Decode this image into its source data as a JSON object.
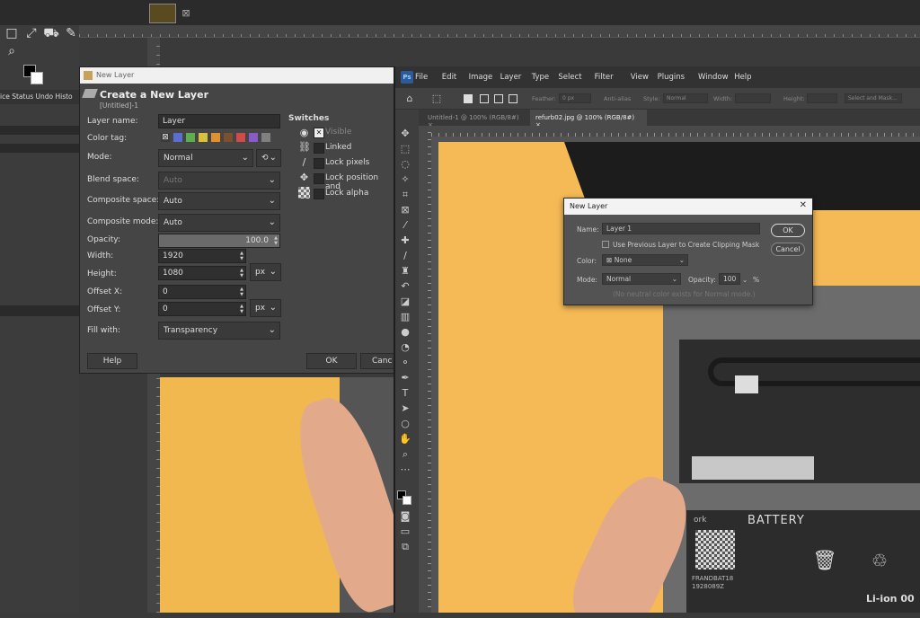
{
  "gimp": {
    "dock_tabs": "ice Status  Undo Histo",
    "dialog": {
      "window_title": "New Layer",
      "header": "Create a New Layer",
      "subtitle": "[Untitled]-1",
      "fields": {
        "layer_name_label": "Layer name:",
        "layer_name_value": "Layer",
        "color_tag_label": "Color tag:",
        "mode_label": "Mode:",
        "mode_value": "Normal",
        "blend_space_label": "Blend space:",
        "blend_space_value": "Auto",
        "composite_space_label": "Composite space:",
        "composite_space_value": "Auto",
        "composite_mode_label": "Composite mode:",
        "composite_mode_value": "Auto",
        "opacity_label": "Opacity:",
        "opacity_value": "100.0",
        "width_label": "Width:",
        "width_value": "1920",
        "height_label": "Height:",
        "height_value": "1080",
        "unit_value": "px",
        "offset_x_label": "Offset X:",
        "offset_x_value": "0",
        "offset_y_label": "Offset Y:",
        "offset_y_value": "0",
        "fill_label": "Fill with:",
        "fill_value": "Transparency"
      },
      "color_tags": [
        "#5a6fd0",
        "#5fae4e",
        "#d9c23a",
        "#e0902e",
        "#7a5030",
        "#d04a4a",
        "#8a5ac8",
        "#808080"
      ],
      "switches": {
        "title": "Switches",
        "visible": "Visible",
        "linked": "Linked",
        "lock_pixels": "Lock pixels",
        "lock_position": "Lock position and",
        "lock_alpha": "Lock alpha"
      },
      "buttons": {
        "help": "Help",
        "ok": "OK",
        "cancel": "Canc"
      }
    }
  },
  "photoshop": {
    "logo": "Ps",
    "menu": [
      "File",
      "Edit",
      "Image",
      "Layer",
      "Type",
      "Select",
      "Filter",
      "View",
      "Plugins",
      "Window",
      "Help"
    ],
    "options": {
      "feather_label": "Feather:",
      "feather_value": "0 px",
      "antialias_label": "Anti-alias",
      "style_label": "Style:",
      "style_value": "Normal",
      "width_label": "Width:",
      "height_label": "Height:",
      "select_mask": "Select and Mask..."
    },
    "tabs": [
      {
        "label": "Untitled-1 @ 100% (RGB/8#)",
        "close": "×"
      },
      {
        "label": "refurb02.jpg @ 100% (RGB/8#)",
        "close": "×"
      }
    ],
    "battery_label": {
      "title": "BATTERY",
      "chem": "Li-ion 00",
      "code": "FRANDBAT18 1928089Z",
      "brand": "ork"
    },
    "dialog": {
      "title": "New Layer",
      "close": "✕",
      "name_label": "Name:",
      "name_value": "Layer 1",
      "clip_label": "Use Previous Layer to Create Clipping Mask",
      "color_label": "Color:",
      "color_value": "None",
      "mode_label": "Mode:",
      "mode_value": "Normal",
      "opacity_label": "Opacity:",
      "opacity_value": "100",
      "opacity_unit": "%",
      "note": "(No neutral color exists for Normal mode.)",
      "ok": "OK",
      "cancel": "Cancel"
    }
  }
}
